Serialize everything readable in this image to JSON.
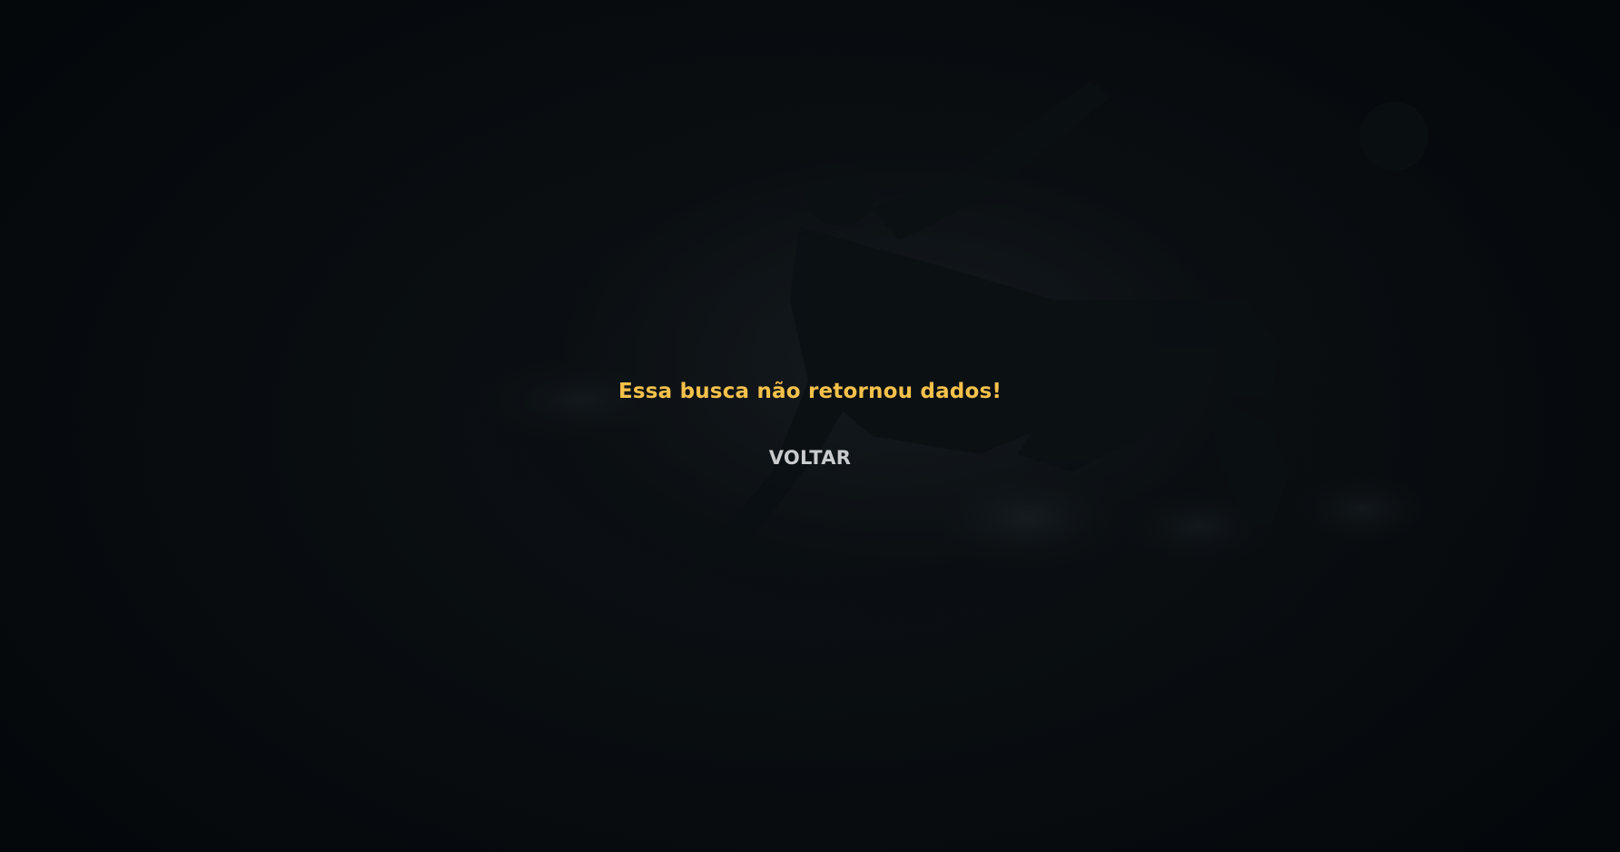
{
  "page": {
    "background_color": "#05090c"
  },
  "notice": {
    "message": "Essa busca não retornou dados!",
    "message_color": "#f5c14a"
  },
  "actions": {
    "back_label": "VOLTAR",
    "back_color": "#c9cbcc"
  },
  "background": {
    "image_subject": "silhouette of a football player performing a bicycle kick, heavily darkened"
  }
}
